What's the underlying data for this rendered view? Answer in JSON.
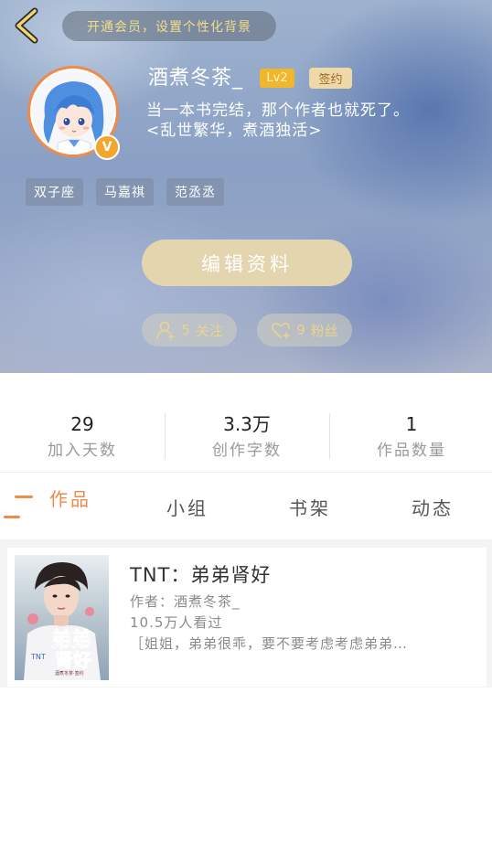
{
  "header": {
    "vip_banner": "开通会员，设置个性化背景",
    "username": "酒煮冬茶_",
    "level_badge": "Lv2",
    "sign_badge": "签约",
    "verified_badge": "V",
    "bio_line1": "当一本书完结，那个作者也就死了。",
    "bio_line2": "<乱世繁华，煮酒独活>",
    "tags": [
      "双子座",
      "马嘉祺",
      "范丞丞"
    ],
    "edit_button": "编辑资料",
    "follow_count": "5",
    "follow_label": "关注",
    "fans_count": "9",
    "fans_label": "粉丝",
    "colors": {
      "accent": "#f08a4b",
      "gold": "#f1b72c",
      "pill_text": "#e9d48d"
    }
  },
  "stats": [
    {
      "value": "29",
      "label": "加入天数"
    },
    {
      "value": "3.3万",
      "label": "创作字数"
    },
    {
      "value": "1",
      "label": "作品数量"
    }
  ],
  "tabs": [
    {
      "label": "作品",
      "active": true
    },
    {
      "label": "小组",
      "active": false
    },
    {
      "label": "书架",
      "active": false
    },
    {
      "label": "动态",
      "active": false
    }
  ],
  "works": [
    {
      "title": "TNT：弟弟肾好",
      "author": "作者：酒煮冬茶_",
      "views": "10.5万人看过",
      "description": "［姐姐，弟弟很乖，要不要考虑考虑弟弟…",
      "cover_text": {
        "main": "弟弟",
        "sub": "肾好",
        "tnt": "TNT",
        "tiny": "酒煮冬茶·签约"
      }
    }
  ],
  "icons": {
    "back": "chevron-left-icon",
    "follow": "user-plus-icon",
    "fans": "heart-plus-icon"
  }
}
